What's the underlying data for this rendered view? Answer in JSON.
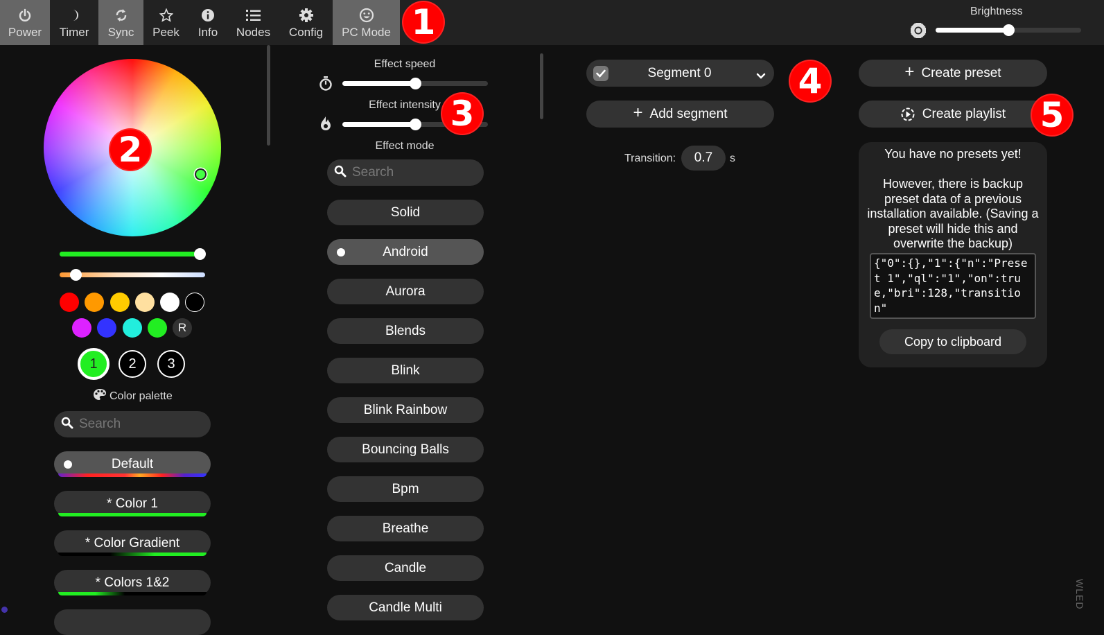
{
  "topbar": {
    "tabs": [
      {
        "label": "Power",
        "icon": "power-icon",
        "active": true
      },
      {
        "label": "Timer",
        "icon": "moon-icon",
        "active": false
      },
      {
        "label": "Sync",
        "icon": "sync-icon",
        "active": true
      },
      {
        "label": "Peek",
        "icon": "star-icon",
        "active": false
      },
      {
        "label": "Info",
        "icon": "info-icon",
        "active": false
      },
      {
        "label": "Nodes",
        "icon": "list-icon",
        "active": false
      },
      {
        "label": "Config",
        "icon": "gear-icon",
        "active": false
      },
      {
        "label": "PC Mode",
        "icon": "smiley-icon",
        "active": true
      }
    ],
    "brightness": {
      "label": "Brightness",
      "value_fraction": 0.5
    }
  },
  "annotations": [
    "1",
    "2",
    "3",
    "4",
    "5"
  ],
  "colors_panel": {
    "wheel_selected_color": "#44ff44",
    "saturation_slider_fraction": 1.0,
    "white_slider_fraction": 0.11,
    "quick_colors": [
      "#ff0000",
      "#ff9900",
      "#ffcc00",
      "#ffe0a0",
      "#ffffff",
      "#000000",
      "#dd22ff",
      "#3333ff",
      "#22eedd",
      "#22ee22"
    ],
    "random_label": "R",
    "slots": [
      {
        "label": "1",
        "color": "#22ee22",
        "selected": true
      },
      {
        "label": "2",
        "color": "#000000",
        "selected": false
      },
      {
        "label": "3",
        "color": "#000000",
        "selected": false
      }
    ],
    "palette_title": "Color palette",
    "palette_search_placeholder": "Search",
    "palettes": [
      {
        "label": "Default",
        "selected": true
      },
      {
        "label": "* Color 1",
        "selected": false
      },
      {
        "label": "* Color Gradient",
        "selected": false
      },
      {
        "label": "* Colors 1&2",
        "selected": false
      }
    ]
  },
  "effects_panel": {
    "speed_label": "Effect speed",
    "speed_fraction": 0.5,
    "intensity_label": "Effect intensity",
    "intensity_fraction": 0.5,
    "mode_label": "Effect mode",
    "search_placeholder": "Search",
    "effects": [
      {
        "label": "Solid",
        "selected": false
      },
      {
        "label": "Android",
        "selected": true
      },
      {
        "label": "Aurora",
        "selected": false
      },
      {
        "label": "Blends",
        "selected": false
      },
      {
        "label": "Blink",
        "selected": false
      },
      {
        "label": "Blink Rainbow",
        "selected": false
      },
      {
        "label": "Bouncing Balls",
        "selected": false
      },
      {
        "label": "Bpm",
        "selected": false
      },
      {
        "label": "Breathe",
        "selected": false
      },
      {
        "label": "Candle",
        "selected": false
      },
      {
        "label": "Candle Multi",
        "selected": false
      }
    ]
  },
  "segments_panel": {
    "segment_name": "Segment 0",
    "add_segment_label": "Add segment",
    "transition_label": "Transition:",
    "transition_value": "0.7",
    "transition_unit": "s"
  },
  "presets_panel": {
    "create_preset_label": "Create preset",
    "create_playlist_label": "Create playlist",
    "no_presets_title": "You have no presets yet!",
    "backup_message": "However, there is backup preset data of a previous installation available. (Saving a preset will hide this and overwrite the backup)",
    "backup_json": "{\"0\":{},\"1\":{\"n\":\"Preset 1\",\"ql\":\"1\",\"on\":true,\"bri\":128,\"transition\"",
    "copy_label": "Copy to clipboard"
  },
  "footer": {
    "brand": "WLED"
  }
}
